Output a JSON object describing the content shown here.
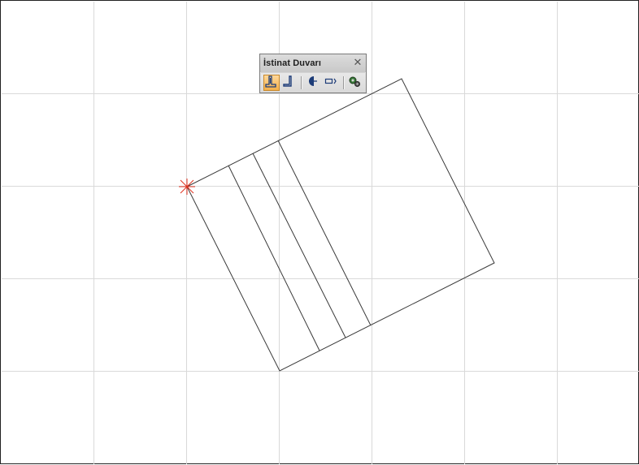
{
  "window": {
    "title": "İstinat Duvarı"
  },
  "toolbar": {
    "title": "İstinat Duvarı",
    "close_glyph": "✕",
    "buttons": [
      {
        "icon": "retaining-wall-icon",
        "active": true
      },
      {
        "icon": "l-profile-icon",
        "active": false
      },
      {
        "icon": "semicircle-section-icon",
        "active": false
      },
      {
        "icon": "wall-extend-icon",
        "active": false
      },
      {
        "icon": "settings-gears-icon",
        "active": false
      }
    ]
  },
  "colors": {
    "grid": "#d9d9d9",
    "drawing_line": "#3a3a3a",
    "cursor_marker": "#e0301e",
    "active_button": "#f4b04a",
    "frame_border": "#222222"
  }
}
